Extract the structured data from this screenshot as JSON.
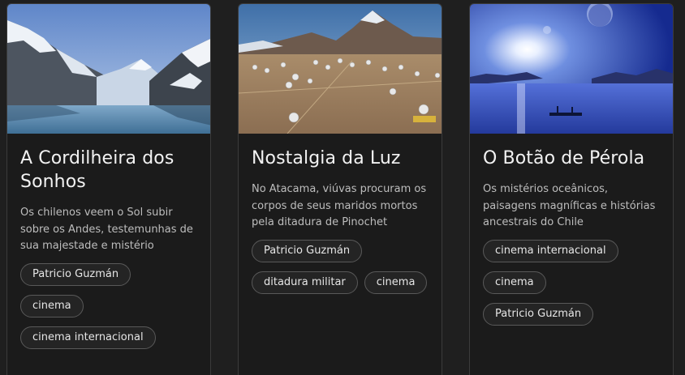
{
  "cards": [
    {
      "image_icon": "mountain-lake-photo",
      "title": "A Cordilheira dos Sonhos",
      "description": "Os chilenos veem o Sol subir sobre os Andes, testemunhas de sua majestade e mistério",
      "tags": [
        "Patricio Guzmán",
        "cinema",
        "cinema internacional"
      ]
    },
    {
      "image_icon": "desert-telescopes-photo",
      "title": "Nostalgia da Luz",
      "description": "No Atacama, viúvas procuram os corpos de seus maridos mortos pela ditadura de Pinochet",
      "tags": [
        "Patricio Guzmán",
        "ditadura militar",
        "cinema"
      ]
    },
    {
      "image_icon": "ocean-night-boat-photo",
      "title": "O Botão de Pérola",
      "description": "Os mistérios oceânicos, paisagens magníficas e histórias ancestrais do Chile",
      "tags": [
        "cinema internacional",
        "cinema",
        "Patricio Guzmán"
      ]
    }
  ]
}
